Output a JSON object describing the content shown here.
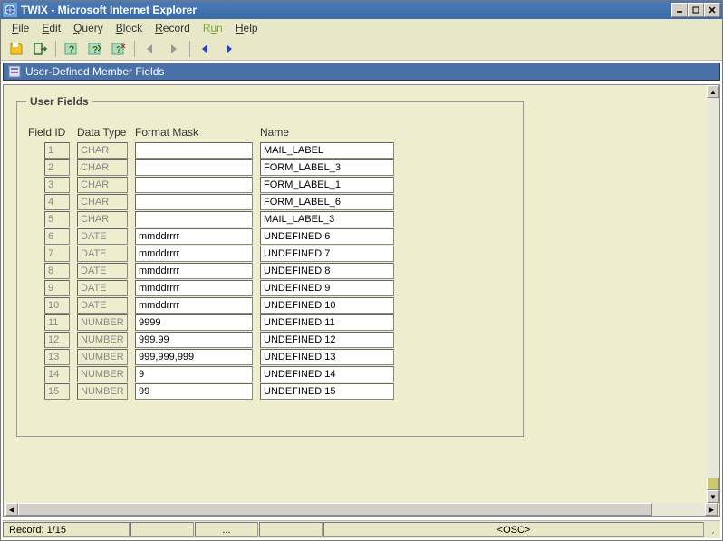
{
  "window": {
    "title": "TWIX - Microsoft Internet Explorer"
  },
  "menu": {
    "file": "File",
    "edit": "Edit",
    "query": "Query",
    "block": "Block",
    "record": "Record",
    "run": "Run",
    "help": "Help"
  },
  "subheader": {
    "title": "User-Defined Member Fields"
  },
  "fieldset": {
    "legend": "User Fields"
  },
  "headers": {
    "id": "Field ID",
    "type": "Data Type",
    "mask": "Format Mask",
    "name": "Name"
  },
  "rows": [
    {
      "id": "1",
      "type": "CHAR",
      "mask": "",
      "name": "MAIL_LABEL"
    },
    {
      "id": "2",
      "type": "CHAR",
      "mask": "",
      "name": "FORM_LABEL_3"
    },
    {
      "id": "3",
      "type": "CHAR",
      "mask": "",
      "name": "FORM_LABEL_1"
    },
    {
      "id": "4",
      "type": "CHAR",
      "mask": "",
      "name": "FORM_LABEL_6"
    },
    {
      "id": "5",
      "type": "CHAR",
      "mask": "",
      "name": "MAIL_LABEL_3"
    },
    {
      "id": "6",
      "type": "DATE",
      "mask": "mmddrrrr",
      "name": "UNDEFINED 6"
    },
    {
      "id": "7",
      "type": "DATE",
      "mask": "mmddrrrr",
      "name": "UNDEFINED 7"
    },
    {
      "id": "8",
      "type": "DATE",
      "mask": "mmddrrrr",
      "name": "UNDEFINED 8"
    },
    {
      "id": "9",
      "type": "DATE",
      "mask": "mmddrrrr",
      "name": "UNDEFINED 9"
    },
    {
      "id": "10",
      "type": "DATE",
      "mask": "mmddrrrr",
      "name": "UNDEFINED 10"
    },
    {
      "id": "11",
      "type": "NUMBER",
      "mask": "9999",
      "name": "UNDEFINED 11"
    },
    {
      "id": "12",
      "type": "NUMBER",
      "mask": "999.99",
      "name": "UNDEFINED 12"
    },
    {
      "id": "13",
      "type": "NUMBER",
      "mask": "999,999,999",
      "name": "UNDEFINED 13"
    },
    {
      "id": "14",
      "type": "NUMBER",
      "mask": "9",
      "name": "UNDEFINED 14"
    },
    {
      "id": "15",
      "type": "NUMBER",
      "mask": "99",
      "name": "UNDEFINED 15"
    }
  ],
  "status": {
    "record": "Record: 1/15",
    "ellipsis": "...",
    "osc": "<OSC>"
  }
}
